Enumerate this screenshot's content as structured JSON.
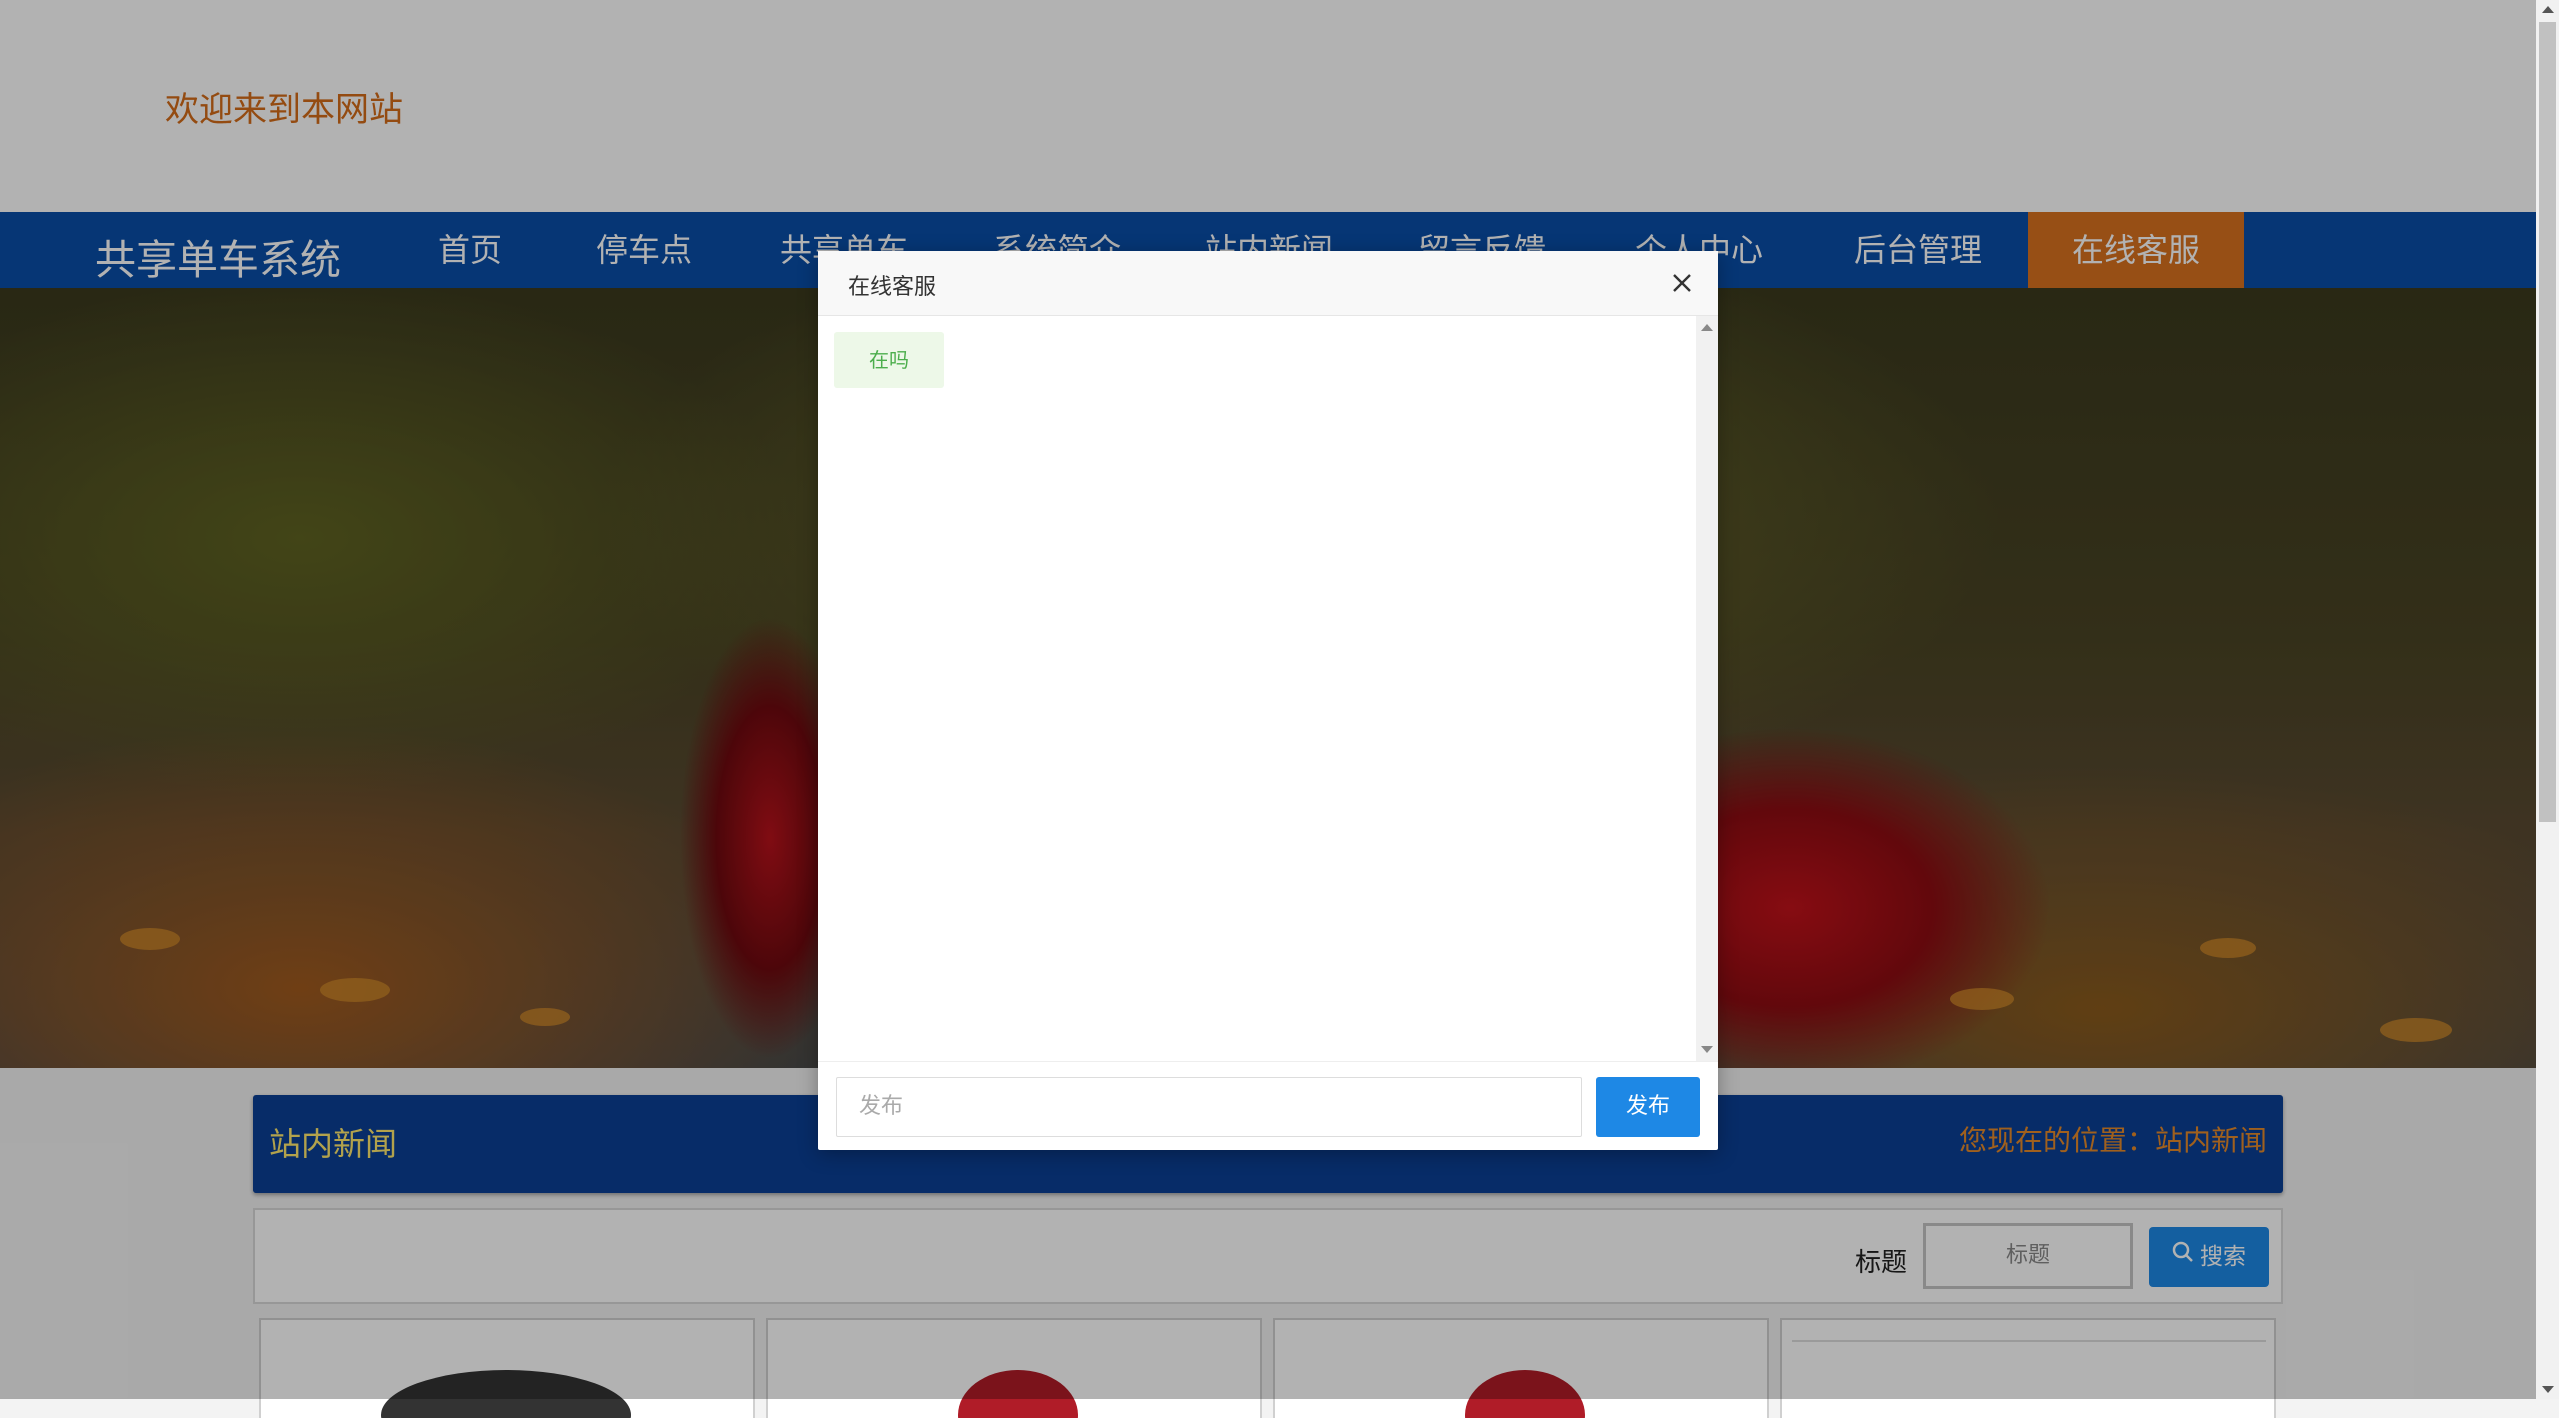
{
  "header": {
    "welcome": "欢迎来到本网站",
    "brand": "共享单车系统"
  },
  "nav": {
    "items": [
      {
        "label": "首页"
      },
      {
        "label": "停车点"
      },
      {
        "label": "共享单车"
      },
      {
        "label": "系统简介"
      },
      {
        "label": "站内新闻"
      },
      {
        "label": "留言反馈"
      },
      {
        "label": "个人中心"
      },
      {
        "label": "后台管理"
      },
      {
        "label": "在线客服"
      }
    ],
    "active": "在线客服"
  },
  "section": {
    "title": "站内新闻",
    "location": "您现在的位置：站内新闻"
  },
  "search": {
    "label": "标题",
    "placeholder": "标题",
    "button": "搜索"
  },
  "dialog": {
    "title": "在线客服",
    "messages": [
      {
        "text": "在吗"
      }
    ],
    "input_placeholder": "发布",
    "send_label": "发布"
  },
  "colors": {
    "nav_bg": "#0a4ea8",
    "accent_orange": "#d9711f",
    "section_title": "#ffe96d",
    "primary_button": "#1e88e5"
  }
}
